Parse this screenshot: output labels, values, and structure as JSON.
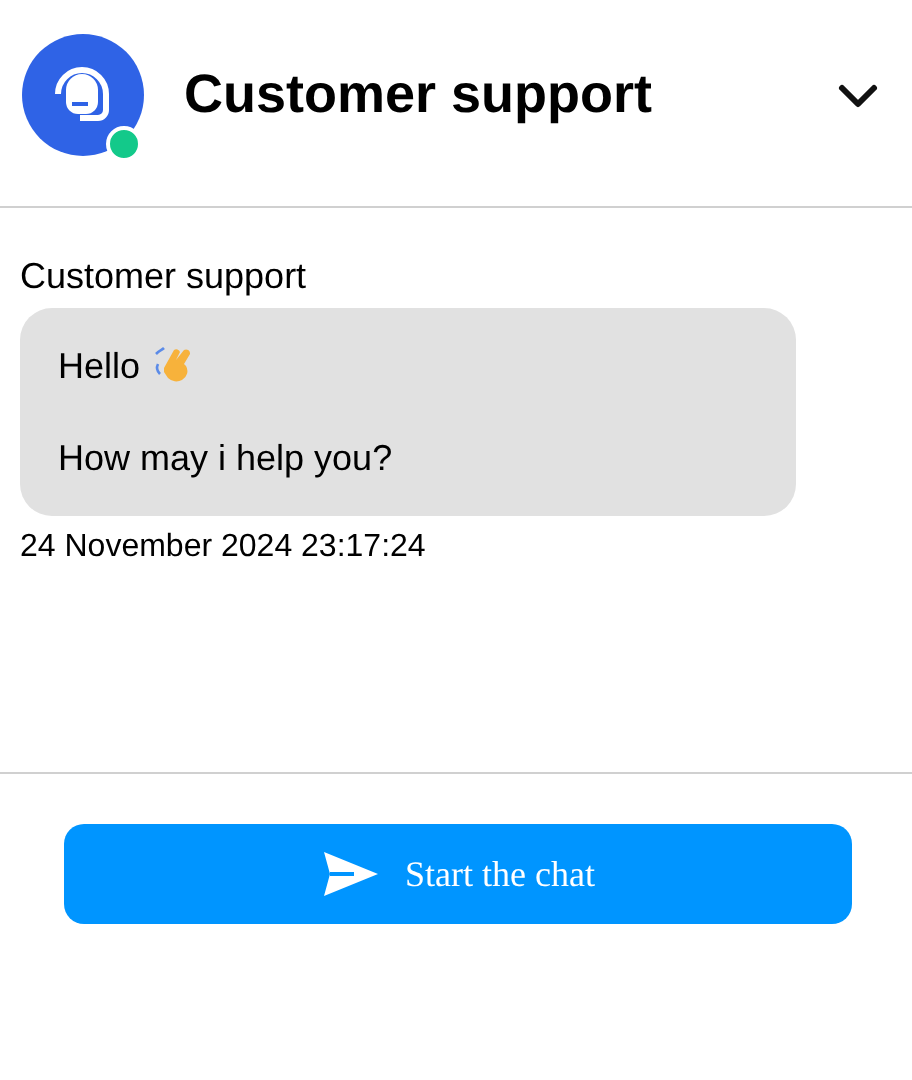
{
  "header": {
    "title": "Customer support",
    "online": true,
    "expanded": true
  },
  "messages": [
    {
      "sender": "Customer support",
      "lines": [
        {
          "text": "Hello",
          "kind": "greeting"
        },
        {
          "text": "How may i help you?",
          "kind": "plain"
        }
      ],
      "time": "24 November 2024 23:17:24"
    }
  ],
  "action": {
    "label": "Start the chat"
  }
}
